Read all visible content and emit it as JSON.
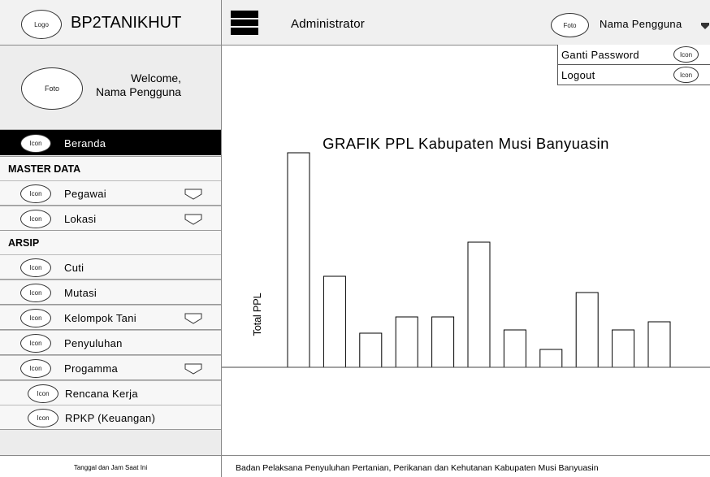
{
  "sidebar": {
    "logo_icon": "Logo",
    "app_name": "BP2TANIKHUT",
    "profile_foto": "Foto",
    "welcome": "Welcome,\nNama Pengguna",
    "home": {
      "icon": "Icon",
      "label": "Beranda"
    },
    "sections": [
      {
        "title": "MASTER DATA"
      },
      {
        "title": "ARSIP"
      }
    ],
    "items": [
      {
        "icon": "Icon",
        "label": "Pegawai"
      },
      {
        "icon": "Icon",
        "label": "Lokasi"
      },
      {
        "icon": "Icon",
        "label": "Cuti"
      },
      {
        "icon": "Icon",
        "label": "Mutasi"
      },
      {
        "icon": "Icon",
        "label": "Kelompok Tani"
      },
      {
        "icon": "Icon",
        "label": "Penyuluhan"
      },
      {
        "icon": "Icon",
        "label": "Progamma"
      },
      {
        "icon": "Icon",
        "label": "Rencana Kerja"
      },
      {
        "icon": "Icon",
        "label": "RPKP (Keuangan)"
      }
    ],
    "footer": "Tanggal dan Jam Saat Ini"
  },
  "topbar": {
    "menu_icon": "hamburger-icon",
    "title": "Administrator",
    "user_foto": "Foto",
    "user_name": "Nama Pengguna"
  },
  "user_menu": [
    {
      "label": "Ganti Password",
      "icon": "Icon"
    },
    {
      "label": "Logout",
      "icon": "Icon"
    }
  ],
  "footer": {
    "text": "Badan Pelaksana Penyuluhan Pertanian, Perikanan dan Kehutanan Kabupaten Musi Banyuasin"
  },
  "chart_data": {
    "type": "bar",
    "title": "GRAFIK PPL Kabupaten Musi Banyuasin",
    "ylabel": "Total PPL",
    "xlabel": "",
    "values": [
      132,
      56,
      21,
      31,
      31,
      77,
      23,
      11,
      46,
      23,
      28
    ],
    "ylim": [
      0,
      140
    ],
    "grid": false,
    "legend": "none"
  }
}
